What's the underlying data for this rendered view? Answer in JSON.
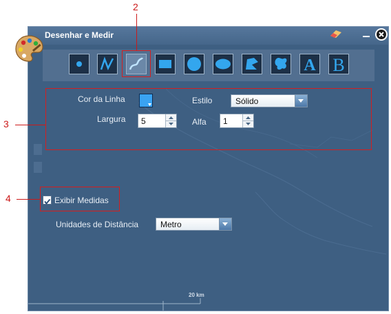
{
  "window": {
    "title": "Desenhar e Medir"
  },
  "icons": {
    "palette": "palette-icon",
    "eraser": "eraser-icon",
    "minimize": "minimize-icon",
    "close": "close-icon"
  },
  "tools": [
    {
      "name": "point-tool",
      "icon": "point-icon"
    },
    {
      "name": "polyline-tool",
      "icon": "polyline-icon"
    },
    {
      "name": "freehand-line-tool",
      "icon": "freehand-line-icon",
      "selected": true
    },
    {
      "name": "rectangle-tool",
      "icon": "rectangle-icon"
    },
    {
      "name": "circle-tool",
      "icon": "circle-icon"
    },
    {
      "name": "ellipse-tool",
      "icon": "ellipse-icon"
    },
    {
      "name": "polygon-tool",
      "icon": "polygon-icon"
    },
    {
      "name": "freehand-polygon-tool",
      "icon": "freehand-polygon-icon"
    },
    {
      "name": "text-tool",
      "icon": "text-a-icon",
      "glyph": "A"
    },
    {
      "name": "text-tool-b",
      "icon": "text-b-icon",
      "glyph": "B"
    }
  ],
  "line": {
    "color_label": "Cor da Linha",
    "color_value": "#3aa3f2",
    "style_label": "Estilo",
    "style_value": "Sólido",
    "width_label": "Largura",
    "width_value": "5",
    "alpha_label": "Alfa",
    "alpha_value": "1"
  },
  "measure": {
    "show_label": "Exibir Medidas",
    "show_checked": true,
    "units_label": "Unidades de Distância",
    "units_value": "Metro"
  },
  "map": {
    "scale_label": "20 km"
  },
  "callouts": [
    "2",
    "3",
    "4"
  ],
  "colors": {
    "window_bg": "#3e5f82",
    "callout_red": "#d61e1e",
    "accent_blue": "#3aa3f2"
  }
}
